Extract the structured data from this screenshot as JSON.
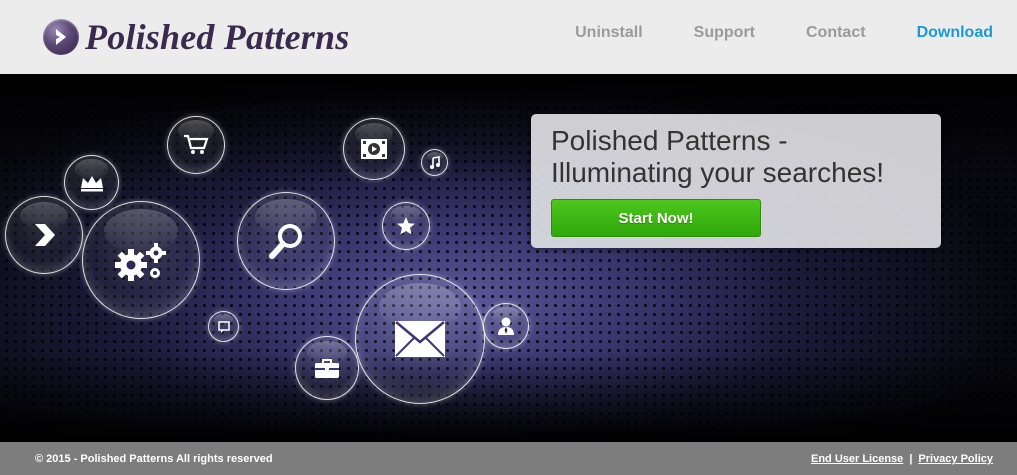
{
  "header": {
    "brand": "Polished Patterns",
    "nav": [
      {
        "label": "Uninstall"
      },
      {
        "label": "Support"
      },
      {
        "label": "Contact"
      },
      {
        "label": "Download",
        "active": true
      }
    ]
  },
  "hero": {
    "headline": "Polished Patterns - Illuminating your searches!",
    "cta_label": "Start Now!",
    "bubbles": [
      "shopping-cart-icon",
      "crown-icon",
      "video-icon",
      "music-note-icon",
      "arrow-icon",
      "gears-icon",
      "search-icon",
      "star-icon",
      "chat-icon",
      "envelope-icon",
      "user-icon",
      "briefcase-icon"
    ]
  },
  "footer": {
    "copyright": "© 2015 - Polished Patterns All rights reserved",
    "links": [
      {
        "label": "End User License"
      },
      {
        "label": "Privacy Policy"
      }
    ],
    "separator": "|"
  },
  "colors": {
    "brand": "#3a2b4e",
    "nav_active": "#1a9bd7",
    "cta": "#3bb613",
    "footer_bg": "#7d7d7d"
  }
}
